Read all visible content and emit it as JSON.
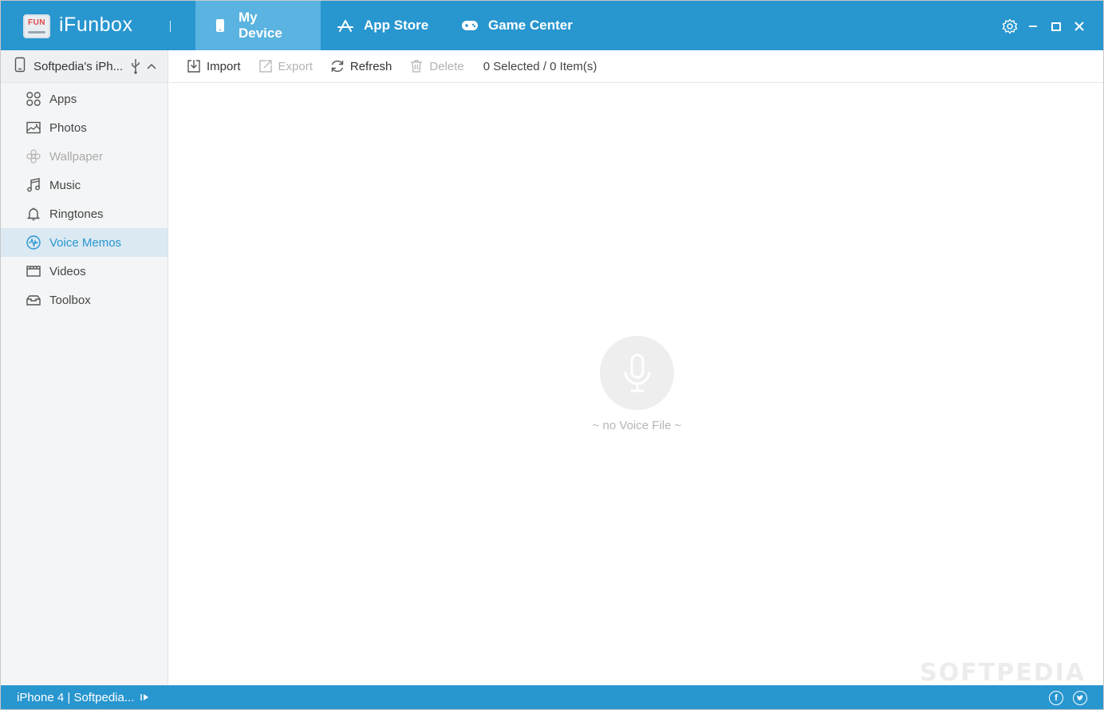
{
  "app": {
    "title": "iFunbox",
    "logo_text": "FUN",
    "accent_color": "#2896cf"
  },
  "nav": {
    "tabs": [
      {
        "label": "My Device",
        "icon": "phone-icon",
        "active": true
      },
      {
        "label": "App Store",
        "icon": "app-store-icon",
        "active": false
      },
      {
        "label": "Game Center",
        "icon": "gamepad-icon",
        "active": false
      }
    ]
  },
  "window_controls": [
    "settings-icon",
    "minimize-icon",
    "maximize-icon",
    "close-icon"
  ],
  "sidebar": {
    "device_name": "Softpedia's iPh...",
    "items": [
      {
        "label": "Apps",
        "icon": "apps-grid-icon",
        "state": "normal"
      },
      {
        "label": "Photos",
        "icon": "photo-icon",
        "state": "normal"
      },
      {
        "label": "Wallpaper",
        "icon": "flower-icon",
        "state": "disabled"
      },
      {
        "label": "Music",
        "icon": "music-note-icon",
        "state": "normal"
      },
      {
        "label": "Ringtones",
        "icon": "bell-icon",
        "state": "normal"
      },
      {
        "label": "Voice Memos",
        "icon": "voice-wave-icon",
        "state": "active"
      },
      {
        "label": "Videos",
        "icon": "film-icon",
        "state": "normal"
      },
      {
        "label": "Toolbox",
        "icon": "toolbox-icon",
        "state": "normal"
      }
    ]
  },
  "toolbar": {
    "import_label": "Import",
    "export_label": "Export",
    "refresh_label": "Refresh",
    "delete_label": "Delete",
    "status": "0 Selected / 0 Item(s)"
  },
  "content": {
    "empty_text": "~ no Voice File ~",
    "empty_icon": "microphone-icon"
  },
  "statusbar": {
    "device_text": "iPhone 4 | Softpedia...",
    "social": [
      "facebook-icon",
      "twitter-icon"
    ]
  },
  "watermark": "SOFTPEDIA"
}
